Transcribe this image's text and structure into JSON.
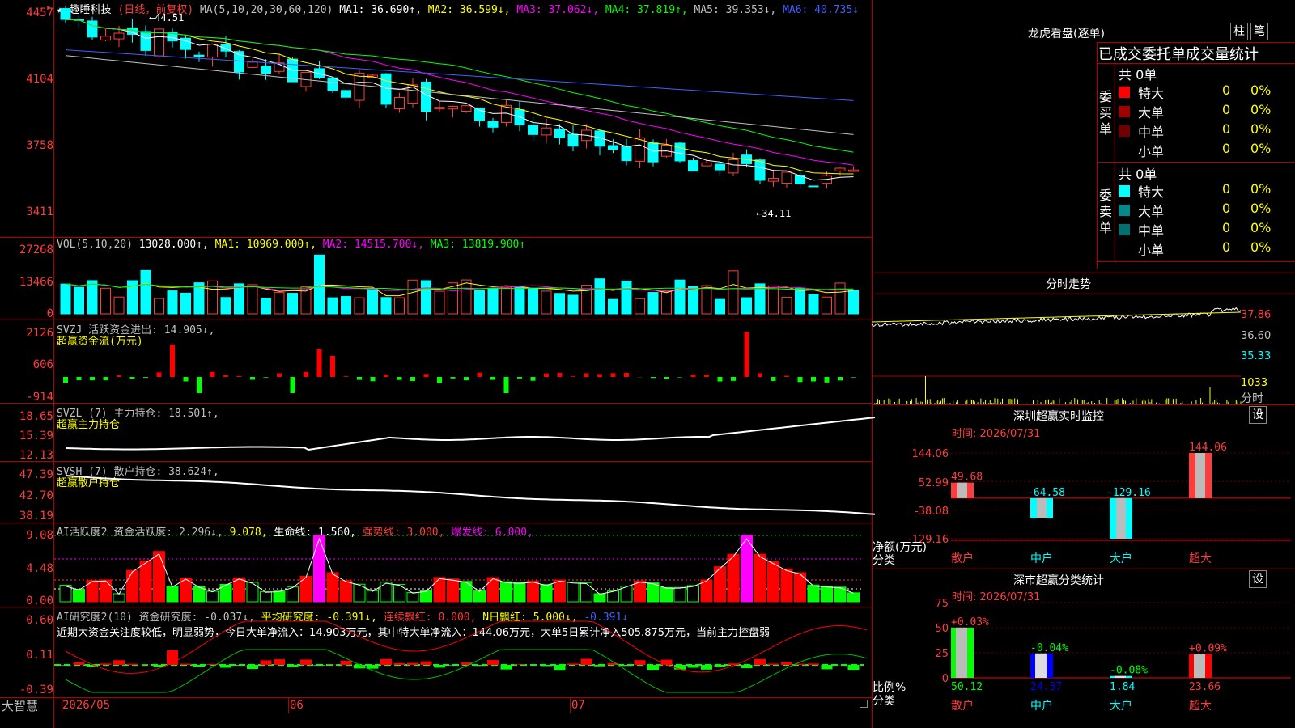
{
  "header": {
    "star": "★",
    "stock_name": "趣睡科技",
    "period": "(日线，前复权)",
    "ma_params": "MA(5,10,20,30,60,120)",
    "ma1": "MA1: 36.690↑,",
    "ma2": "MA2: 36.599↓,",
    "ma3": "MA3: 37.062↓,",
    "ma4": "MA4: 37.819↑,",
    "ma5": "MA5: 39.353↓,",
    "ma6": "MA6: 40.735↓",
    "high_mark": "←44.51",
    "low_mark": "←34.11",
    "y_ticks": [
      "4457",
      "4104",
      "3758",
      "3411"
    ]
  },
  "vol": {
    "title": "VOL(5,10,20)",
    "value": "13028.000↑,",
    "ma1": "MA1: 10969.000↑,",
    "ma2": "MA2: 14515.700↓,",
    "ma3": "MA3: 13819.900↑",
    "y_ticks": [
      "27268",
      "13466",
      "0"
    ]
  },
  "svzj": {
    "title": "SVZJ  活跃资金进出: 14.905↓,",
    "subtitle": "超赢资金流(万元)",
    "y_ticks": [
      "2126",
      "606",
      "-914"
    ]
  },
  "svzl": {
    "title": "SVZL (7) 主力持仓: 18.501↑,",
    "subtitle": "超赢主力持仓",
    "y_ticks": [
      "18.65",
      "15.39",
      "12.13"
    ]
  },
  "svsh": {
    "title": "SVSH (7) 散户持仓: 38.624↑,",
    "subtitle": "超赢散户持仓",
    "y_ticks": [
      "47.39",
      "42.70",
      "38.19"
    ]
  },
  "ai1": {
    "title_a": "AI活跃度2 资金活跃度: 2.296↓,",
    "title_b": " 9.078,",
    "title_c": " 生命线: 1.560,",
    "title_d": " 强势线: 3.000,",
    "title_e": " 爆发线: 6.000,",
    "y_ticks": [
      "9.08",
      "4.48",
      "0.00"
    ]
  },
  "ai2": {
    "title_a": "AI研究度2(10) 资金研究度: -0.037↓,",
    "title_b": " 平均研究度: -0.391↓,",
    "title_c": " 连续飘红: 0.000,",
    "title_d": " N日飘红: 5.000↓,",
    "title_e": " -0.391↓",
    "comment": "近期大资金关注度较低，明显弱势，今日大单净流入：14.903万元，其中特大单净流入：144.06万元，大单5日累计净入505.875万元，当前主力控盘弱",
    "y_ticks": [
      "0.60",
      "0.11",
      "-0.39"
    ]
  },
  "xaxis": {
    "brand": "大智慧",
    "labels": [
      "2026/05",
      "06",
      "07"
    ]
  },
  "dragon": {
    "title": "龙虎看盘(逐单)",
    "btn1": "柱",
    "btn2": "笔",
    "subtitle": "已成交委托单成交量统计",
    "buy_label": "委买单",
    "sell_label": "委卖单",
    "buy_total": "共 0单",
    "sell_total": "共 0单",
    "buy_rows": [
      {
        "name": "特大",
        "count": "0",
        "pct": "0%",
        "color": "#ff0000"
      },
      {
        "name": "大单",
        "count": "0",
        "pct": "0%",
        "color": "#a00000"
      },
      {
        "name": "中单",
        "count": "0",
        "pct": "0%",
        "color": "#700000"
      },
      {
        "name": "小单",
        "count": "0",
        "pct": "0%",
        "color": ""
      }
    ],
    "sell_rows": [
      {
        "name": "特大",
        "count": "0",
        "pct": "0%",
        "color": "#00ffff"
      },
      {
        "name": "大单",
        "count": "0",
        "pct": "0%",
        "color": "#008b8b"
      },
      {
        "name": "中单",
        "count": "0",
        "pct": "0%",
        "color": "#007070"
      },
      {
        "name": "小单",
        "count": "0",
        "pct": "0%",
        "color": ""
      }
    ]
  },
  "intraday": {
    "title": "分时走势",
    "price_ticks": [
      "37.86",
      "36.60",
      "35.33"
    ],
    "vol_tick": "1033",
    "vol_label": "分时"
  },
  "monitor": {
    "title": "深圳超赢实时监控",
    "btn": "设",
    "time": "时间: 2026/07/31",
    "y_ticks": [
      "144.06",
      "52.99",
      "-38.08",
      "-129.16"
    ],
    "y_caption_1": "净额(万元)",
    "y_caption_2": "分类",
    "categories": [
      "散户",
      "中户",
      "大户",
      "超大"
    ],
    "values": [
      49.68,
      -64.58,
      -129.16,
      144.06
    ],
    "labels": [
      "49.68",
      "-64.58",
      "-129.16",
      "144.06"
    ]
  },
  "classify": {
    "title": "深市超赢分类统计",
    "btn": "设",
    "time": "时间: 2026/07/31",
    "y_ticks": [
      "75",
      "50",
      "25",
      "0"
    ],
    "y_caption_1": "比例%",
    "y_caption_2": "分类",
    "categories": [
      "散户",
      "中户",
      "大户",
      "超大"
    ],
    "values": [
      50.12,
      24.37,
      1.84,
      23.66
    ],
    "value_labels": [
      "50.12",
      "24.37",
      "1.84",
      "23.66"
    ],
    "changes": [
      "+0.03%",
      "-0.04%",
      "-0.08%",
      "+0.09%"
    ]
  }
}
